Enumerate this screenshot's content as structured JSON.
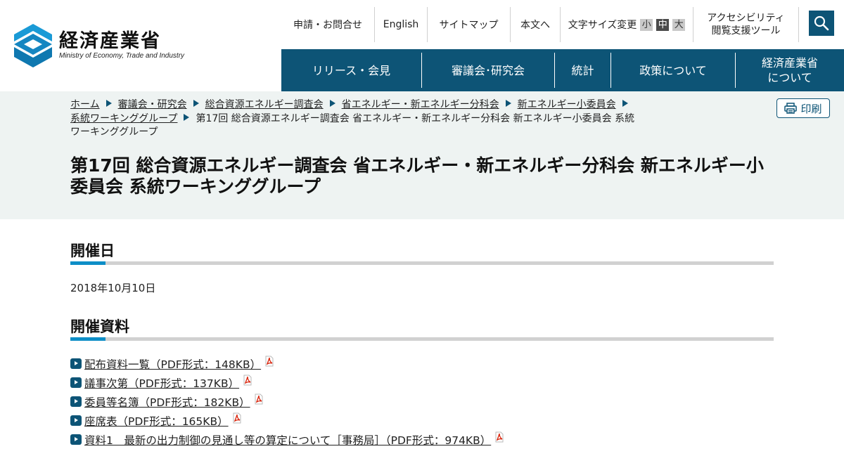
{
  "header": {
    "logo": {
      "jp": "経済産業省",
      "en": "Ministry of Economy, Trade and Industry"
    },
    "utility": {
      "contact": "申請・お問合せ",
      "english": "English",
      "sitemap": "サイトマップ",
      "main_text": "本文へ",
      "font_size_label": "文字サイズ変更",
      "font_small": "小",
      "font_medium": "中",
      "font_large": "大",
      "accessibility_line1": "アクセシビリティ",
      "accessibility_line2": "閲覧支援ツール"
    },
    "gnav": {
      "release": "リリース・会見",
      "council": "審議会･研究会",
      "statistics": "統計",
      "policy": "政策について",
      "about_line1": "経済産業省",
      "about_line2": "について"
    }
  },
  "breadcrumb": {
    "items": [
      "ホーム",
      "審議会・研究会",
      "総合資源エネルギー調査会",
      "省エネルギー・新エネルギー分科会",
      "新エネルギー小委員会",
      "系統ワーキンググループ"
    ],
    "current": "第17回 総合資源エネルギー調査会 省エネルギー・新エネルギー分科会 新エネルギー小委員会 系統ワーキンググループ"
  },
  "print_label": "印刷",
  "page_title": "第17回 総合資源エネルギー調査会 省エネルギー・新エネルギー分科会 新エネルギー小委員会 系統ワーキンググループ",
  "sections": {
    "date_heading": "開催日",
    "date_value": "2018年10月10日",
    "materials_heading": "開催資料"
  },
  "documents": [
    "配布資料一覧（PDF形式：148KB）",
    "議事次第（PDF形式：137KB）",
    "委員等名簿（PDF形式：182KB）",
    "座席表（PDF形式：165KB）",
    "資料1　最新の出力制御の見通し等の算定について［事務局］（PDF形式：974KB）"
  ],
  "colors": {
    "brand": "#0d5476",
    "accent": "#0d8ec7",
    "band": "#eef3f2",
    "pdf": "#d81e05"
  }
}
